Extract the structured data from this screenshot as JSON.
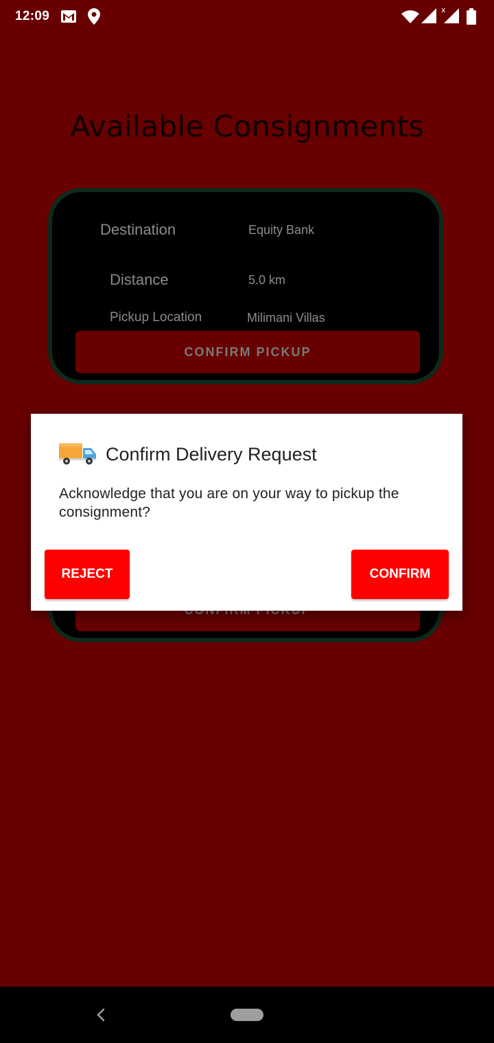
{
  "status_bar": {
    "time": "12:09",
    "icons": [
      "gmail-icon",
      "location-icon",
      "wifi-icon",
      "cell-signal-icon",
      "cell-signal-no-data-icon",
      "battery-icon"
    ]
  },
  "page": {
    "title": "Available Consignments"
  },
  "cards": [
    {
      "destination_label": "Destination",
      "destination_value": "Equity Bank",
      "distance_label": "Distance",
      "distance_value": "5.0 km",
      "pickup_label": "Pickup Location",
      "pickup_value": "Milimani Villas",
      "button_label": "CONFIRM PICKUP"
    },
    {
      "button_label": "CONFIRM PICKUP"
    }
  ],
  "dialog": {
    "icon": "delivery-truck-icon",
    "title": "Confirm Delivery Request",
    "message": "Acknowledge that you are on your way to pickup the consignment?",
    "reject_label": "REJECT",
    "confirm_label": "CONFIRM"
  },
  "nav_bar": {
    "icons": [
      "back-icon",
      "home-pill-icon"
    ]
  },
  "colors": {
    "background": "#680000",
    "card_background": "#000000",
    "card_border": "#0f2a1c",
    "dialog_button": "#ff0000",
    "dialog_background": "#ffffff"
  }
}
